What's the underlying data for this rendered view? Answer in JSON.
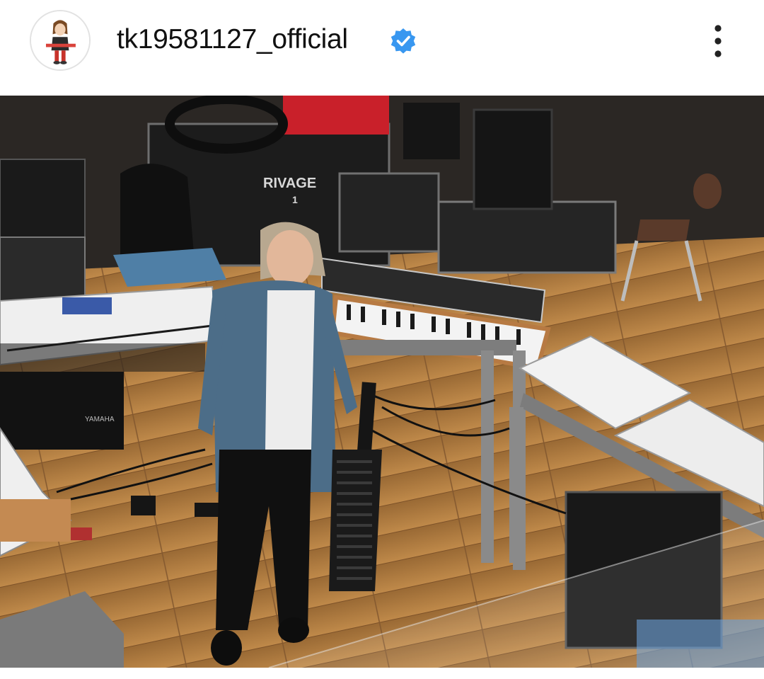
{
  "post": {
    "username": "tk19581127_official",
    "verified": true,
    "avatar_icon": "cartoon-avatar",
    "menu_icon": "more-vertical-icon"
  },
  "photo": {
    "rack_case_label": "RIVAGE",
    "rack_case_number": "1",
    "stand_brand_label": "YAMAHA"
  },
  "colors": {
    "verified_badge": "#3897f0",
    "text": "#111111",
    "floor_wood": "#b8813f"
  }
}
